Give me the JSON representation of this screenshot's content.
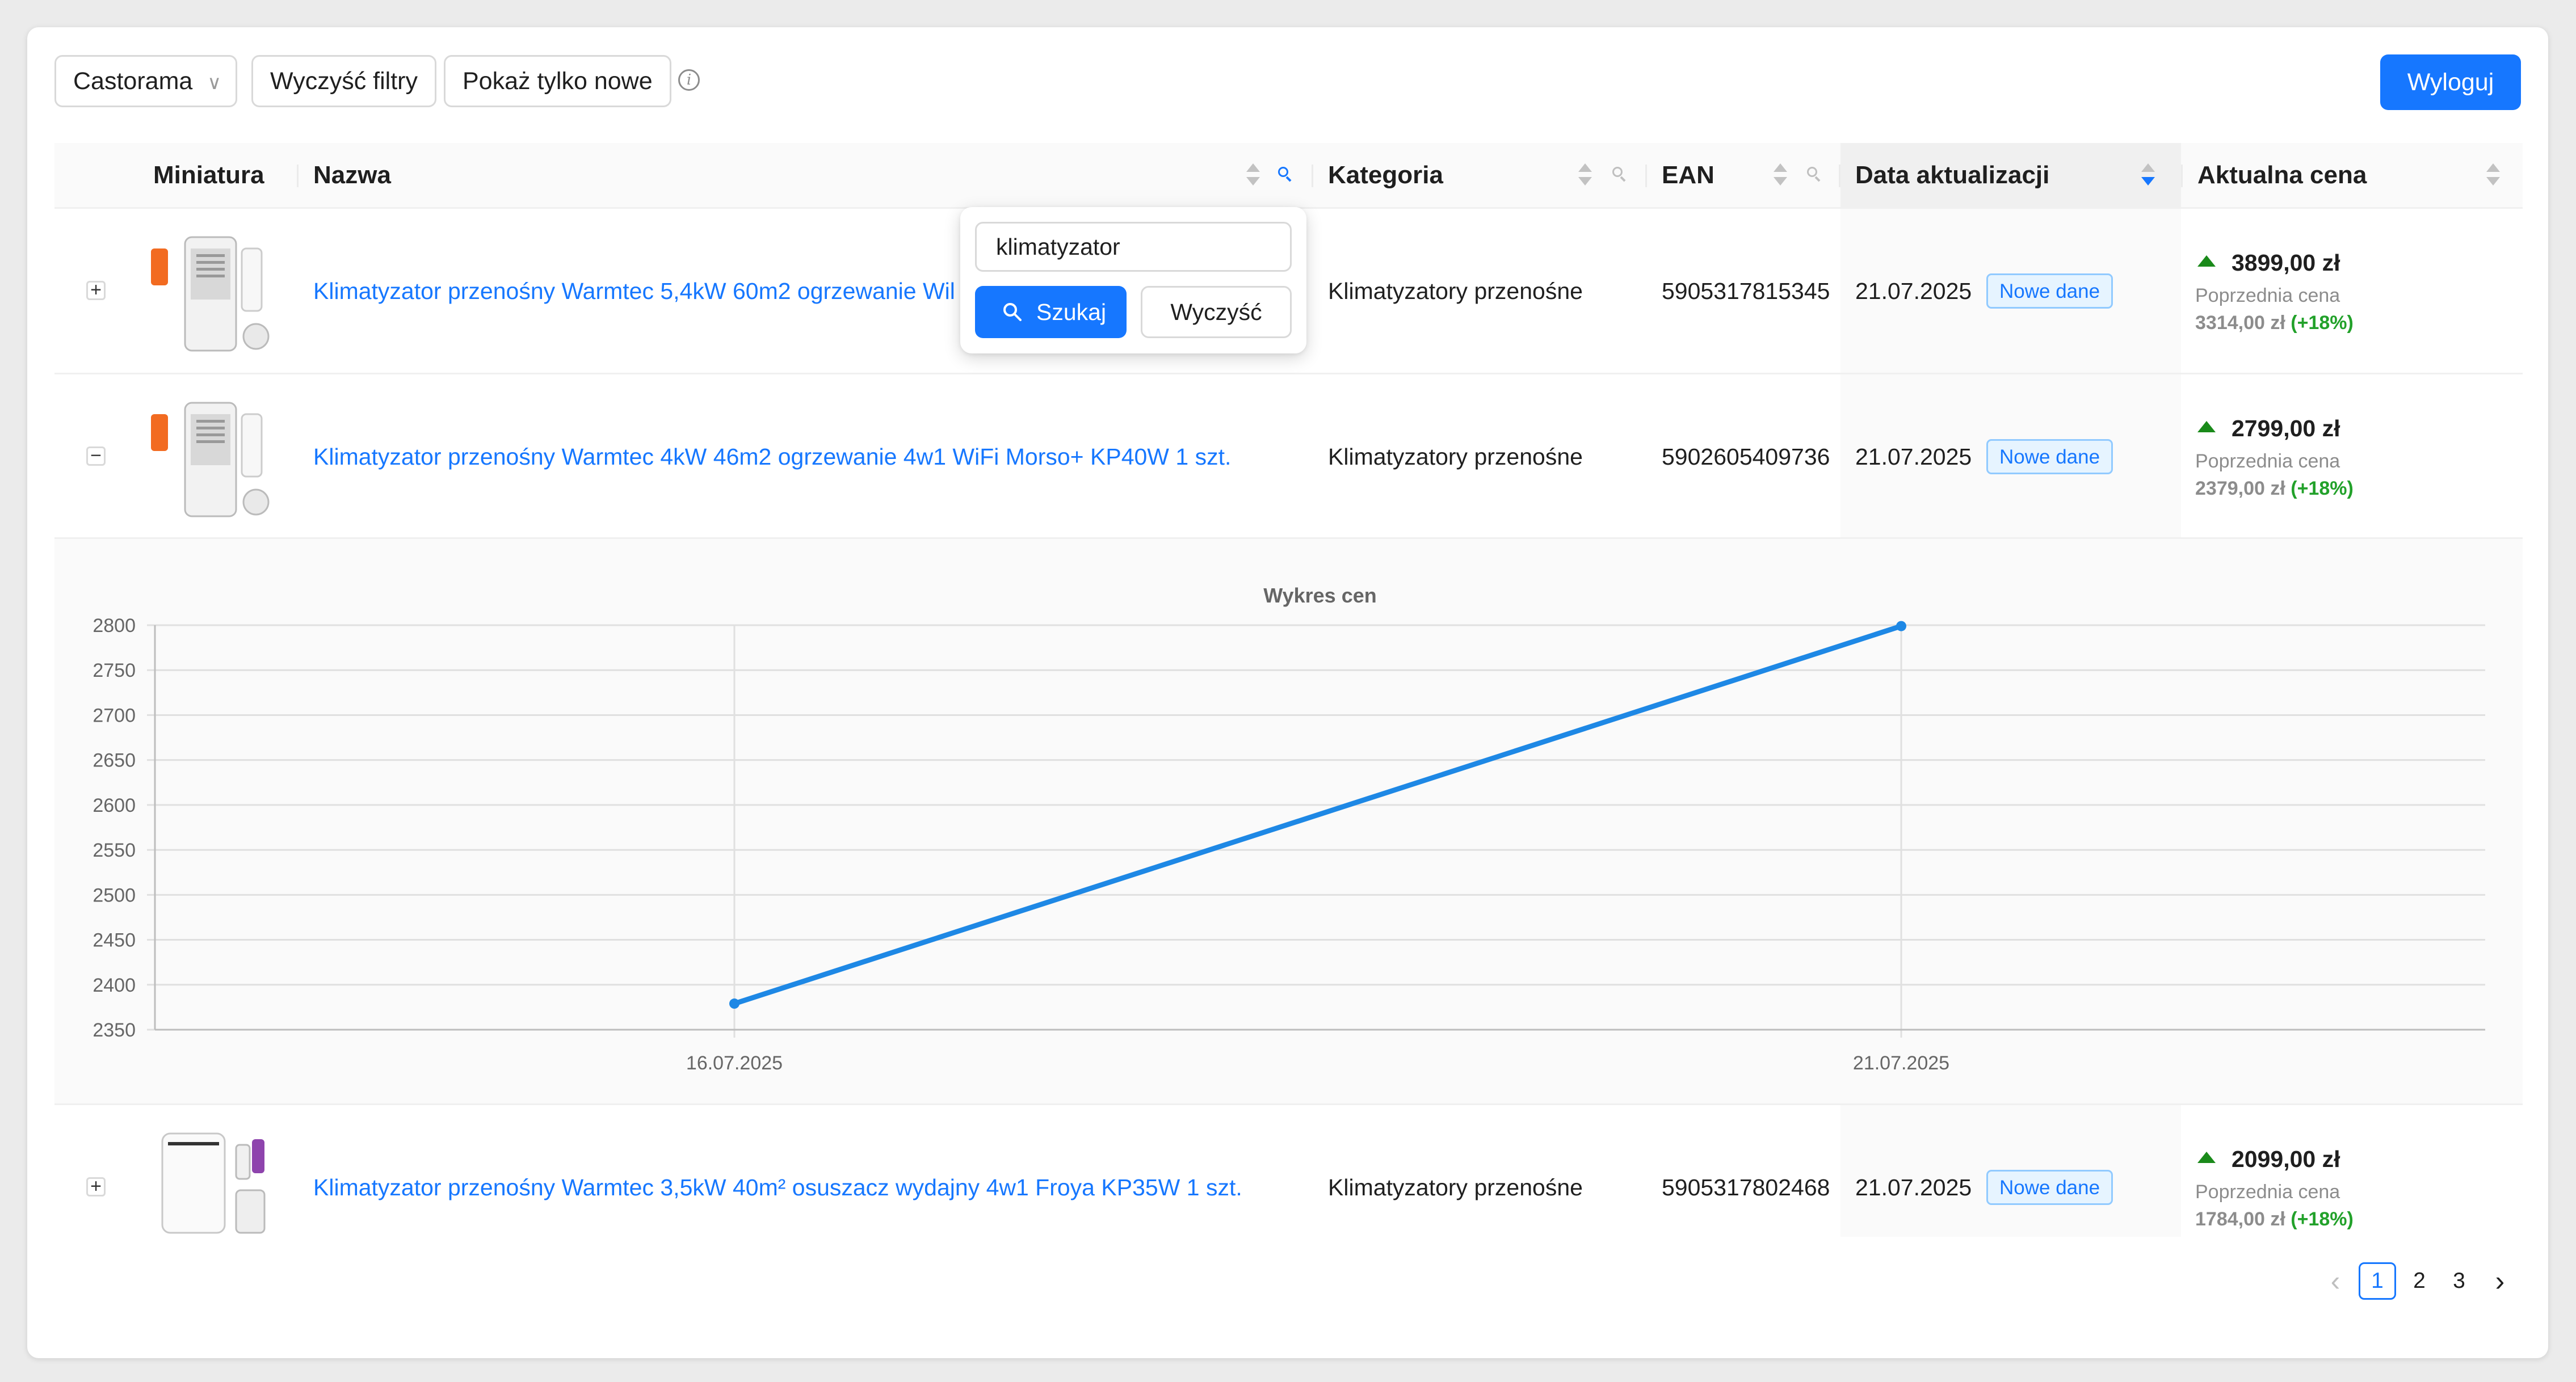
{
  "toolbar": {
    "store_select": "Castorama",
    "clear_filters": "Wyczyść filtry",
    "show_new_only": "Pokaż tylko nowe",
    "logout": "Wyloguj"
  },
  "table": {
    "columns": [
      "Miniatura",
      "Nazwa",
      "Kategoria",
      "EAN",
      "Data aktualizacji",
      "Aktualna cena"
    ],
    "rows": [
      {
        "name": "Klimatyzator przenośny Warmtec 5,4kW 60m2 ogrzewanie Wil",
        "category": "Klimatyzatory przenośne",
        "ean": "5905317815345",
        "date": "21.07.2025",
        "badge": "Nowe dane",
        "price": "3899,00 zł",
        "prev_label": "Poprzednia cena",
        "prev_price": "3314,00 zł",
        "change": "(+18%)",
        "expand_symbol": "+"
      },
      {
        "name": "Klimatyzator przenośny Warmtec 4kW 46m2 ogrzewanie 4w1 WiFi Morso+ KP40W 1 szt.",
        "category": "Klimatyzatory przenośne",
        "ean": "5902605409736",
        "date": "21.07.2025",
        "badge": "Nowe dane",
        "price": "2799,00 zł",
        "prev_label": "Poprzednia cena",
        "prev_price": "2379,00 zł",
        "change": "(+18%)",
        "expand_symbol": "−"
      },
      {
        "name": "Klimatyzator przenośny Warmtec 3,5kW 40m² osuszacz wydajny 4w1 Froya KP35W 1 szt.",
        "category": "Klimatyzatory przenośne",
        "ean": "5905317802468",
        "date": "21.07.2025",
        "badge": "Nowe dane",
        "price": "2099,00 zł",
        "prev_label": "Poprzednia cena",
        "prev_price": "1784,00 zł",
        "change": "(+18%)",
        "expand_symbol": "+"
      }
    ]
  },
  "search_popup": {
    "value": "klimatyzator",
    "search_label": "Szukaj",
    "clear_label": "Wyczyść"
  },
  "pagination": {
    "prev": "‹",
    "pages": [
      "1",
      "2",
      "3"
    ],
    "current": "1",
    "next": "›"
  },
  "chart_data": {
    "type": "line",
    "title": "Wykres cen",
    "x": [
      "16.07.2025",
      "21.07.2025"
    ],
    "series": [
      {
        "values": [
          2379,
          2799
        ]
      }
    ],
    "yticks": [
      2350,
      2400,
      2450,
      2500,
      2550,
      2600,
      2650,
      2700,
      2750,
      2800
    ],
    "ylim": [
      2350,
      2800
    ],
    "grid": true,
    "line_color": "#1e88e5"
  }
}
